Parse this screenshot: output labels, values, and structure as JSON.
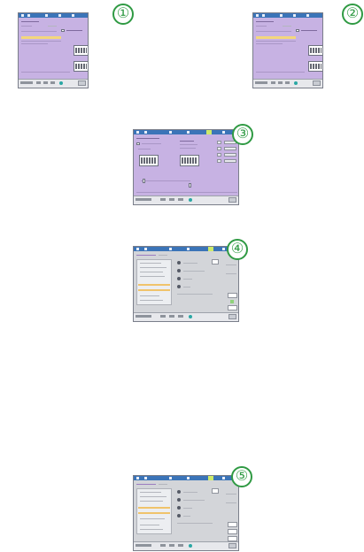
{
  "callouts": [
    "①",
    "②",
    "③",
    "④",
    "⑤"
  ],
  "colors": {
    "purple_panel": "#c7b2e3",
    "gray_panel": "#d3d5d9",
    "titlebar": "#3b74b8",
    "callout_green": "#2f9a43",
    "selection": "#f3d77c",
    "highlight_tab": "#cdea6a"
  },
  "icons": [
    "toolbar-icon",
    "status-dot-icon",
    "grip-icon"
  ]
}
